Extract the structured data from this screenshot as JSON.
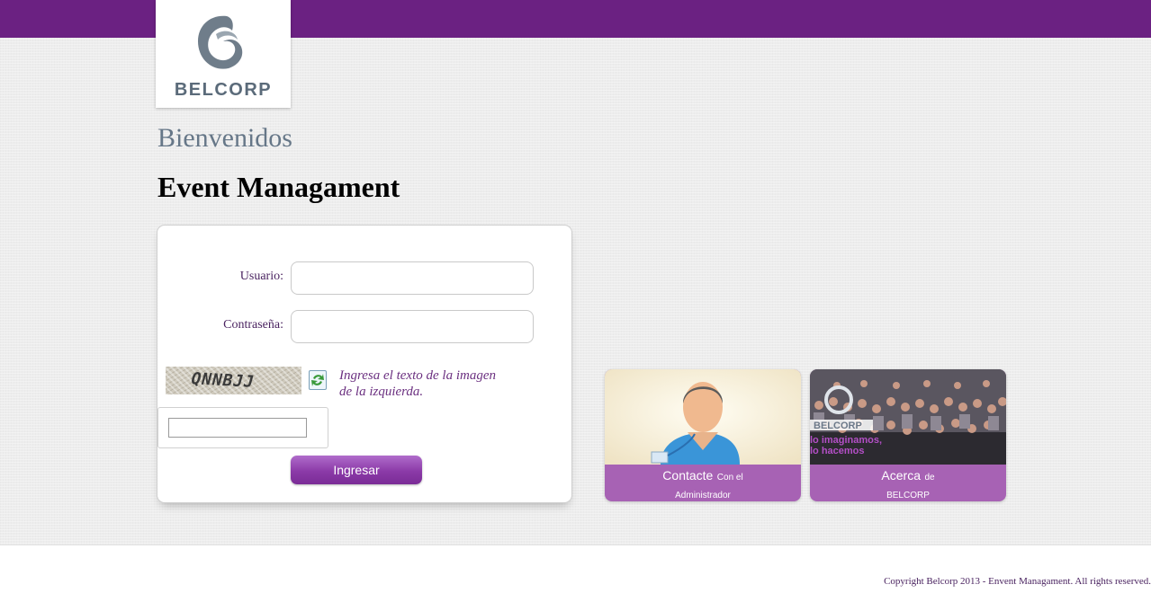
{
  "brand": {
    "logo_text": "BELCORP",
    "primary_color": "#6b2182",
    "tile_color": "#a762b4"
  },
  "header": {
    "welcome": "Bienvenidos",
    "app_title": "Event Managament"
  },
  "login": {
    "user_label": "Usuario:",
    "user_value": "",
    "password_label": "Contraseña:",
    "password_value": "",
    "captcha_text": "QNNBJJ",
    "captcha_hint_line1": "Ingresa el texto de la imagen",
    "captcha_hint_line2": "de la izquierda.",
    "captcha_value": "",
    "submit_label": "Ingresar",
    "refresh_icon": "refresh-icon"
  },
  "tiles": [
    {
      "title": "Contacte",
      "title_small": "Con el",
      "subtitle": "Administrador",
      "icon": "administrator-person-icon"
    },
    {
      "title": "Acerca",
      "title_small": "de",
      "subtitle": "BELCORP",
      "image_text_line1": "lo imaginamos,",
      "image_text_line2": "lo hacemos"
    }
  ],
  "footer": {
    "copyright": "Copyright Belcorp 2013 - Envent Managament. All rights reserved."
  }
}
